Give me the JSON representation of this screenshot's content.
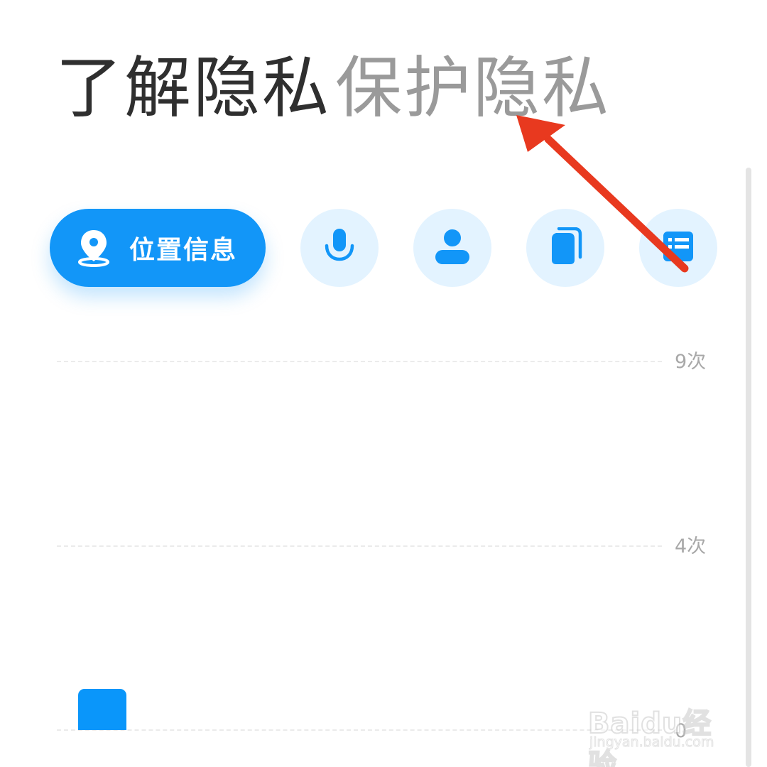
{
  "tabs": [
    {
      "label": "了解隐私",
      "active": true
    },
    {
      "label": "保护隐私",
      "active": false
    }
  ],
  "categories": [
    {
      "label": "位置信息",
      "icon": "location-pin-icon",
      "selected": true
    },
    {
      "icon": "microphone-icon",
      "selected": false
    },
    {
      "icon": "contacts-person-icon",
      "selected": false
    },
    {
      "icon": "files-icon",
      "selected": false
    },
    {
      "icon": "call-log-list-icon",
      "selected": false
    }
  ],
  "colors": {
    "accent": "#1296f8",
    "icon_bg": "#e3f3ff",
    "annotation_arrow": "#e8391f"
  },
  "chart_data": {
    "type": "bar",
    "y_ticks": [
      "9次",
      "4次",
      "0"
    ],
    "ylim": [
      0,
      9
    ],
    "values": [
      1
    ],
    "grid": true
  },
  "watermark": {
    "main": "Baidu经验",
    "sub": "jingyan.baidu.com"
  }
}
